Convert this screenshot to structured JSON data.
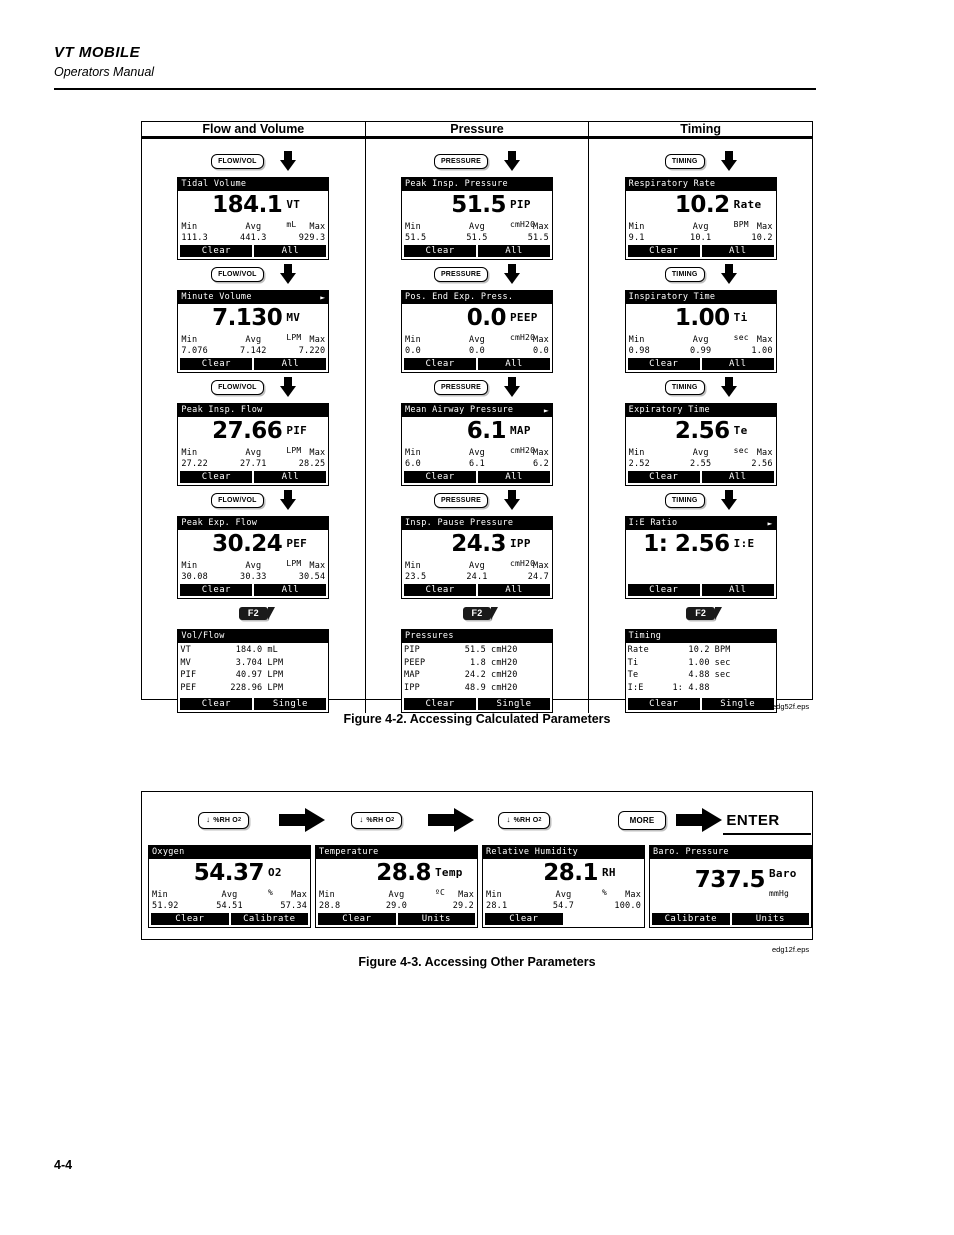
{
  "header": {
    "title": "VT MOBILE",
    "subtitle": "Operators Manual"
  },
  "footer": {
    "page_number": "4-4"
  },
  "figure2": {
    "caption": "Figure 4-2. Accessing Calculated Parameters",
    "eps": "edg52f.eps",
    "columns": [
      {
        "heading": "Flow and Volume",
        "key_label": "FLOW/VOL",
        "f2_label": "F2",
        "screens": [
          {
            "title": "Tidal Volume",
            "more": false,
            "value": "184.1",
            "unit_main": "VT",
            "unit_sub": "mL",
            "stats_labels": [
              "Min",
              "Avg",
              "Max"
            ],
            "stats_values": [
              "111.3",
              "441.3",
              "929.3"
            ],
            "softkeys": [
              "Clear",
              "All"
            ]
          },
          {
            "title": "Minute Volume",
            "more": true,
            "value": "7.130",
            "unit_main": "MV",
            "unit_sub": "LPM",
            "stats_labels": [
              "Min",
              "Avg",
              "Max"
            ],
            "stats_values": [
              "7.076",
              "7.142",
              "7.220"
            ],
            "softkeys": [
              "Clear",
              "All"
            ]
          },
          {
            "title": "Peak Insp. Flow",
            "more": false,
            "value": "27.66",
            "unit_main": "PIF",
            "unit_sub": "LPM",
            "stats_labels": [
              "Min",
              "Avg",
              "Max"
            ],
            "stats_values": [
              "27.22",
              "27.71",
              "28.25"
            ],
            "softkeys": [
              "Clear",
              "All"
            ]
          },
          {
            "title": "Peak Exp. Flow",
            "more": false,
            "value": "30.24",
            "unit_main": "PEF",
            "unit_sub": "LPM",
            "stats_labels": [
              "Min",
              "Avg",
              "Max"
            ],
            "stats_values": [
              "30.08",
              "30.33",
              "30.54"
            ],
            "softkeys": [
              "Clear",
              "All"
            ]
          }
        ],
        "summary": {
          "title": "Vol/Flow",
          "rows": [
            {
              "label": "VT",
              "value": "184.0",
              "unit": "mL"
            },
            {
              "label": "MV",
              "value": "3.704",
              "unit": "LPM"
            },
            {
              "label": "PIF",
              "value": "40.97",
              "unit": "LPM"
            },
            {
              "label": "PEF",
              "value": "228.96",
              "unit": "LPM"
            }
          ],
          "softkeys": [
            "Clear",
            "Single"
          ]
        }
      },
      {
        "heading": "Pressure",
        "key_label": "PRESSURE",
        "f2_label": "F2",
        "screens": [
          {
            "title": "Peak Insp. Pressure",
            "more": false,
            "value": "51.5",
            "unit_main": "PIP",
            "unit_sub": "cmH20",
            "stats_labels": [
              "Min",
              "Avg",
              "Max"
            ],
            "stats_values": [
              "51.5",
              "51.5",
              "51.5"
            ],
            "softkeys": [
              "Clear",
              "All"
            ]
          },
          {
            "title": "Pos. End Exp. Press.",
            "more": false,
            "value": "0.0",
            "unit_main": "PEEP",
            "unit_sub": "cmH20",
            "stats_labels": [
              "Min",
              "Avg",
              "Max"
            ],
            "stats_values": [
              "0.0",
              "0.0",
              "0.0"
            ],
            "softkeys": [
              "Clear",
              "All"
            ]
          },
          {
            "title": "Mean Airway Pressure",
            "more": true,
            "value": "6.1",
            "unit_main": "MAP",
            "unit_sub": "cmH20",
            "stats_labels": [
              "Min",
              "Avg",
              "Max"
            ],
            "stats_values": [
              "6.0",
              "6.1",
              "6.2"
            ],
            "softkeys": [
              "Clear",
              "All"
            ]
          },
          {
            "title": "Insp. Pause Pressure",
            "more": false,
            "value": "24.3",
            "unit_main": "IPP",
            "unit_sub": "cmH20",
            "stats_labels": [
              "Min",
              "Avg",
              "Max"
            ],
            "stats_values": [
              "23.5",
              "24.1",
              "24.7"
            ],
            "softkeys": [
              "Clear",
              "All"
            ]
          }
        ],
        "summary": {
          "title": "Pressures",
          "rows": [
            {
              "label": "PIP",
              "value": "51.5",
              "unit": "cmH20"
            },
            {
              "label": "PEEP",
              "value": "1.8",
              "unit": "cmH20"
            },
            {
              "label": "MAP",
              "value": "24.2",
              "unit": "cmH20"
            },
            {
              "label": "IPP",
              "value": "48.9",
              "unit": "cmH20"
            }
          ],
          "softkeys": [
            "Clear",
            "Single"
          ]
        }
      },
      {
        "heading": "Timing",
        "key_label": "TIMING",
        "f2_label": "F2",
        "screens": [
          {
            "title": "Respiratory Rate",
            "more": false,
            "value": "10.2",
            "unit_main": "Rate",
            "unit_sub": "BPM",
            "stats_labels": [
              "Min",
              "Avg",
              "Max"
            ],
            "stats_values": [
              "9.1",
              "10.1",
              "10.2"
            ],
            "softkeys": [
              "Clear",
              "All"
            ]
          },
          {
            "title": "Inspiratory Time",
            "more": false,
            "value": "1.00",
            "unit_main": "Ti",
            "unit_sub": "sec",
            "stats_labels": [
              "Min",
              "Avg",
              "Max"
            ],
            "stats_values": [
              "0.98",
              "0.99",
              "1.00"
            ],
            "softkeys": [
              "Clear",
              "All"
            ]
          },
          {
            "title": "Expiratory Time",
            "more": false,
            "value": "2.56",
            "unit_main": "Te",
            "unit_sub": "sec",
            "stats_labels": [
              "Min",
              "Avg",
              "Max"
            ],
            "stats_values": [
              "2.52",
              "2.55",
              "2.56"
            ],
            "softkeys": [
              "Clear",
              "All"
            ]
          },
          {
            "title": "I:E Ratio",
            "more": true,
            "value": "1: 2.56",
            "unit_main": "I:E",
            "unit_sub": "",
            "stats_labels": [
              "",
              "",
              ""
            ],
            "stats_values": [
              "",
              "",
              ""
            ],
            "softkeys": [
              "Clear",
              "All"
            ]
          }
        ],
        "summary": {
          "title": "Timing",
          "rows": [
            {
              "label": "Rate",
              "value": "10.2",
              "unit": "BPM"
            },
            {
              "label": "Ti",
              "value": "1.00",
              "unit": "sec"
            },
            {
              "label": "Te",
              "value": "4.88",
              "unit": "sec"
            },
            {
              "label": "I:E",
              "value": "1: 4.88",
              "unit": ""
            }
          ],
          "softkeys": [
            "Clear",
            "Single"
          ]
        }
      }
    ]
  },
  "figure3": {
    "caption": "Figure 4-3. Accessing Other Parameters",
    "eps": "edg12f.eps",
    "keys": {
      "rh_o2_label": "%RH O",
      "rh_o2_sub": "2",
      "more_label": "MORE",
      "enter_label": "ENTER"
    },
    "screens": [
      {
        "title": "Oxygen",
        "value": "54.37",
        "unit_main": "O2",
        "unit_sub": "%",
        "stats_labels": [
          "Min",
          "Avg",
          "Max"
        ],
        "stats_values": [
          "51.92",
          "54.51",
          "57.34"
        ],
        "softkeys": [
          "Clear",
          "Calibrate"
        ]
      },
      {
        "title": "Temperature",
        "value": "28.8",
        "unit_main": "Temp",
        "unit_sub": "ºC",
        "stats_labels": [
          "Min",
          "Avg",
          "Max"
        ],
        "stats_values": [
          "28.8",
          "29.0",
          "29.2"
        ],
        "softkeys": [
          "Clear",
          "Units"
        ]
      },
      {
        "title": "Relative Humidity",
        "value": "28.1",
        "unit_main": "RH",
        "unit_sub": "%",
        "stats_labels": [
          "Min",
          "Avg",
          "Max"
        ],
        "stats_values": [
          "28.1",
          "54.7",
          "100.0"
        ],
        "softkeys": [
          "Clear",
          ""
        ]
      },
      {
        "title": "Baro. Pressure",
        "value": "737.5",
        "unit_main": "Baro",
        "unit_sub": "mmHg",
        "stats_labels": [
          "",
          "",
          ""
        ],
        "stats_values": [
          "",
          "",
          ""
        ],
        "softkeys": [
          "Calibrate",
          "Units"
        ]
      }
    ]
  }
}
